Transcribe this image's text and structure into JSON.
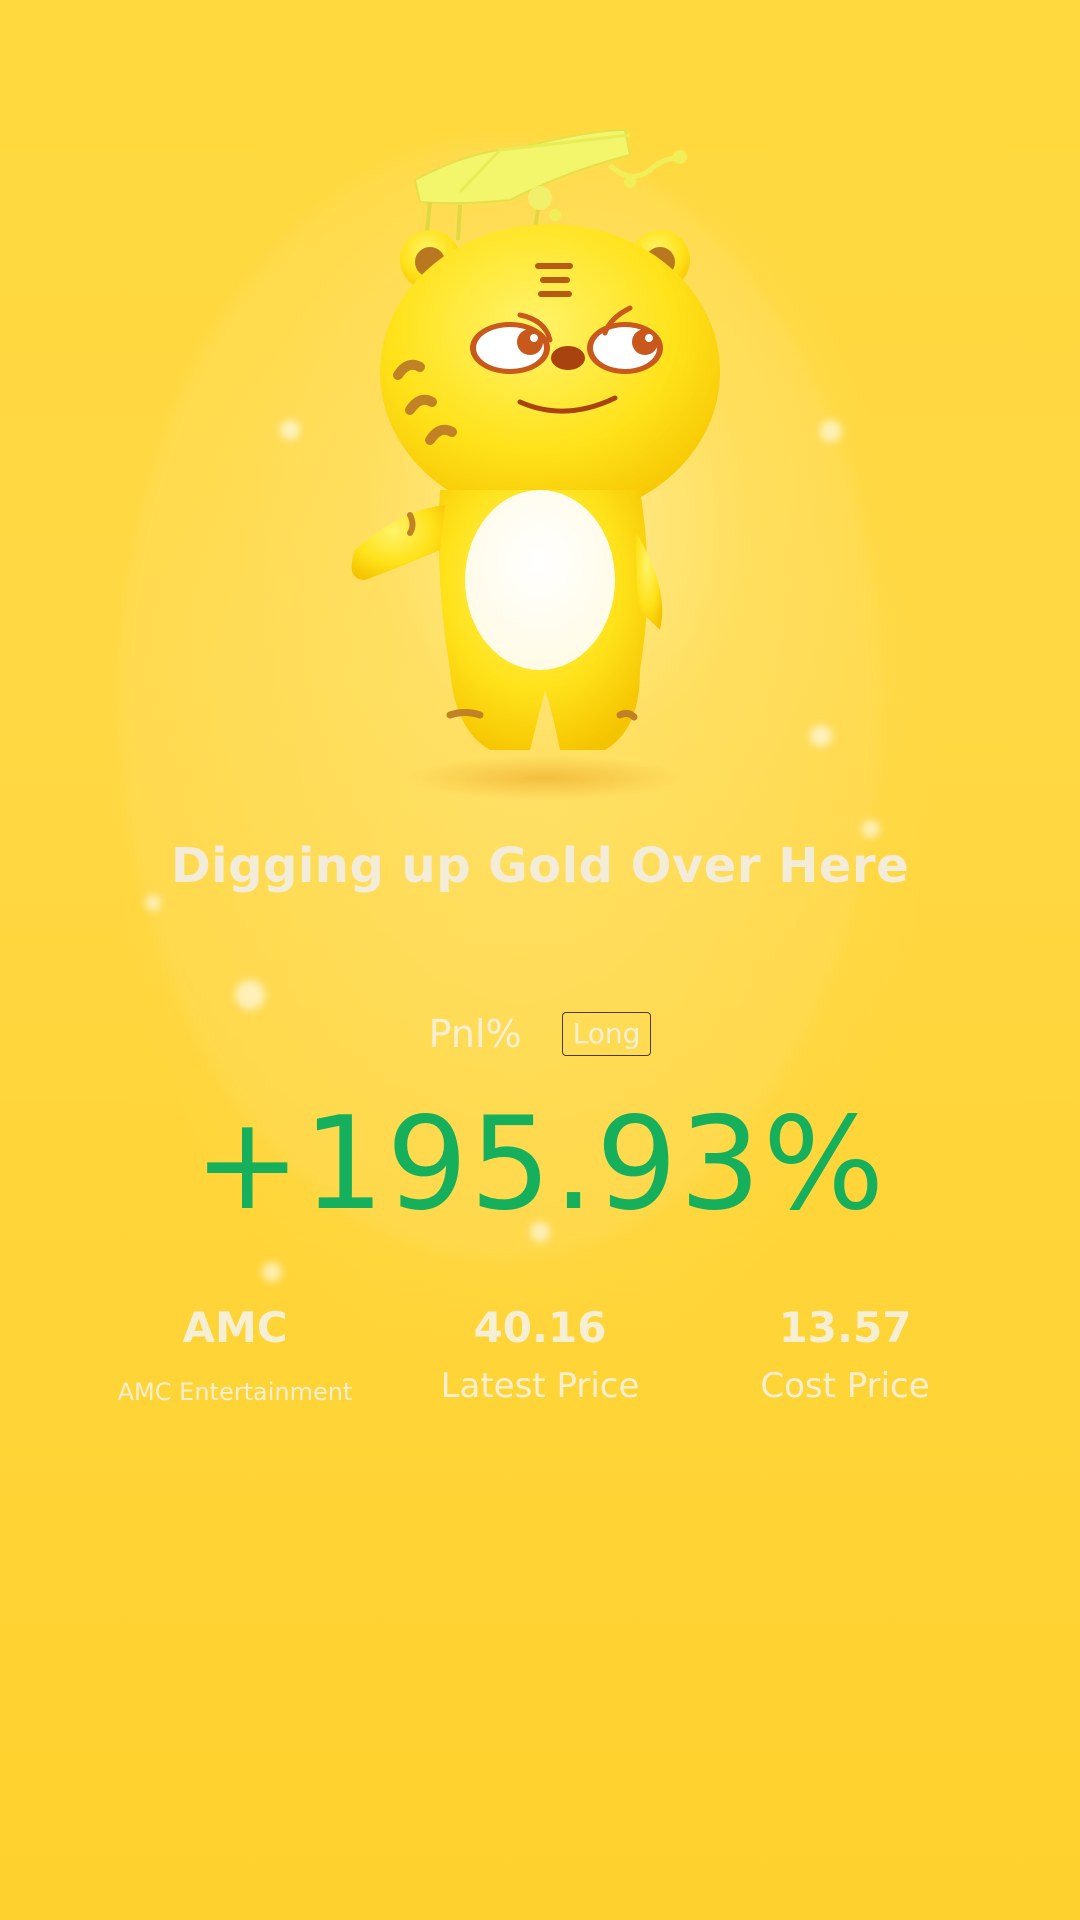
{
  "headline": "Digging up Gold Over Here",
  "pnl": {
    "label": "Pnl%",
    "direction": "Long",
    "value": "+195.93%"
  },
  "stats": [
    {
      "value": "AMC",
      "label": "AMC Entertainment"
    },
    {
      "value": "40.16",
      "label": "Latest Price"
    },
    {
      "value": "13.57",
      "label": "Cost Price"
    }
  ],
  "colors": {
    "background": "#ffd93d",
    "positive": "#16b05c",
    "text_light": "#f7efd3"
  },
  "icons": {
    "mascot": "tiger-mascot-icon"
  }
}
